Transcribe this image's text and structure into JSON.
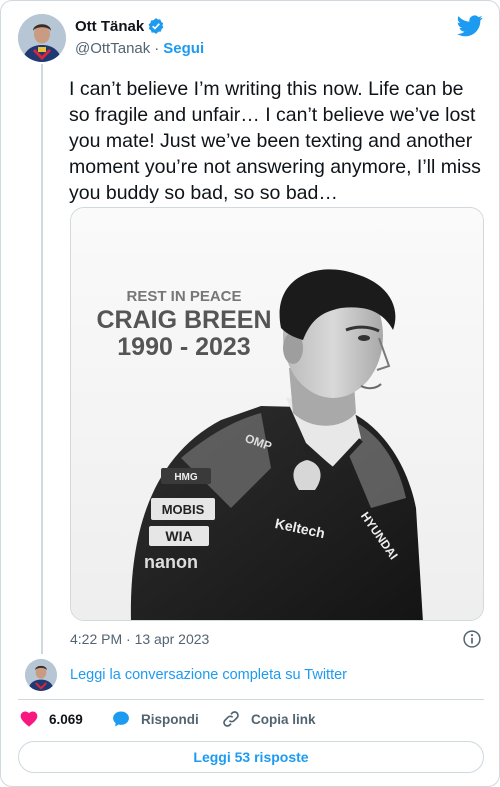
{
  "author": {
    "name": "Ott Tänak",
    "handle": "@OttTanak",
    "separator": "·",
    "follow_label": "Segui"
  },
  "tweet": {
    "text": "I can’t believe I’m writing this now. Life can be so fragile and unfair… I can’t believe we’ve lost you mate! Just we’ve been texting and another moment you’re not answering anymore, I’ll miss you buddy so bad, so so bad…",
    "timestamp": "4:22 PM · 13 apr 2023"
  },
  "media": {
    "caption_line1": "REST IN PEACE",
    "caption_line2": "CRAIG BREEN",
    "caption_line3": "1990 - 2023",
    "sponsors": {
      "hmg": "HMG",
      "mobis": "MOBIS",
      "wia": "WIA",
      "kelltech": "Keltech",
      "hyundai": "HYUNDAI",
      "omp": "OMP",
      "nanon": "nanon"
    }
  },
  "conversation": {
    "link_label": "Leggi la conversazione completa su Twitter"
  },
  "actions": {
    "like_count": "6.069",
    "reply_label": "Rispondi",
    "copy_label": "Copia link",
    "read_replies_label": "Leggi 53 risposte"
  },
  "colors": {
    "accent": "#1d9bf0",
    "like": "#f91880",
    "muted": "#536471",
    "border": "#cfd9de"
  }
}
